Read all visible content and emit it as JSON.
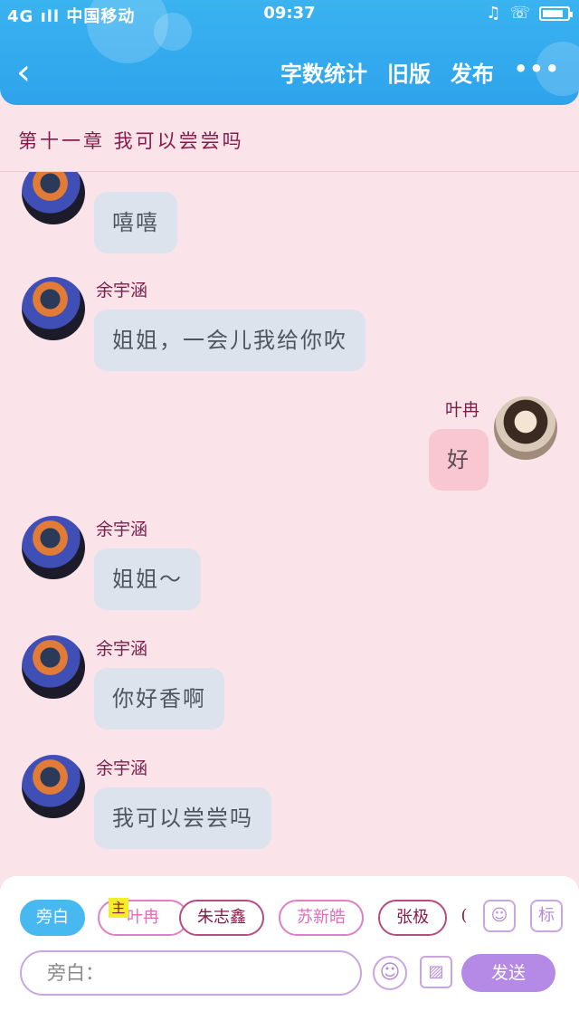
{
  "status_bar": {
    "carrier": "4G ıll 中国移动",
    "time": "09:37",
    "battery_level": 0.85
  },
  "header": {
    "back_icon": "chevron-left-icon",
    "actions": [
      "字数统计",
      "旧版",
      "发布"
    ],
    "more_label": "•••"
  },
  "chapter": {
    "title": "第十一章  我可以尝尝吗"
  },
  "messages": [
    {
      "name": "",
      "text": "嘻嘻"
    },
    {
      "name": "余宇涵",
      "text": "姐姐，一会儿我给你吹"
    },
    {
      "name": "叶冉",
      "text": "好"
    },
    {
      "name": "余宇涵",
      "text": "姐姐～"
    },
    {
      "name": "余宇涵",
      "text": "你好香啊"
    },
    {
      "name": "余宇涵",
      "text": "我可以尝尝吗"
    }
  ],
  "roles": {
    "items": [
      "旁白",
      "叶冉",
      "朱志鑫",
      "苏新皓",
      "张极"
    ],
    "active": "旁白",
    "main_tag": "主",
    "partial_label": "("
  },
  "composer": {
    "placeholder": "旁白：",
    "send_label": "发送",
    "role_icon_label": "标"
  }
}
